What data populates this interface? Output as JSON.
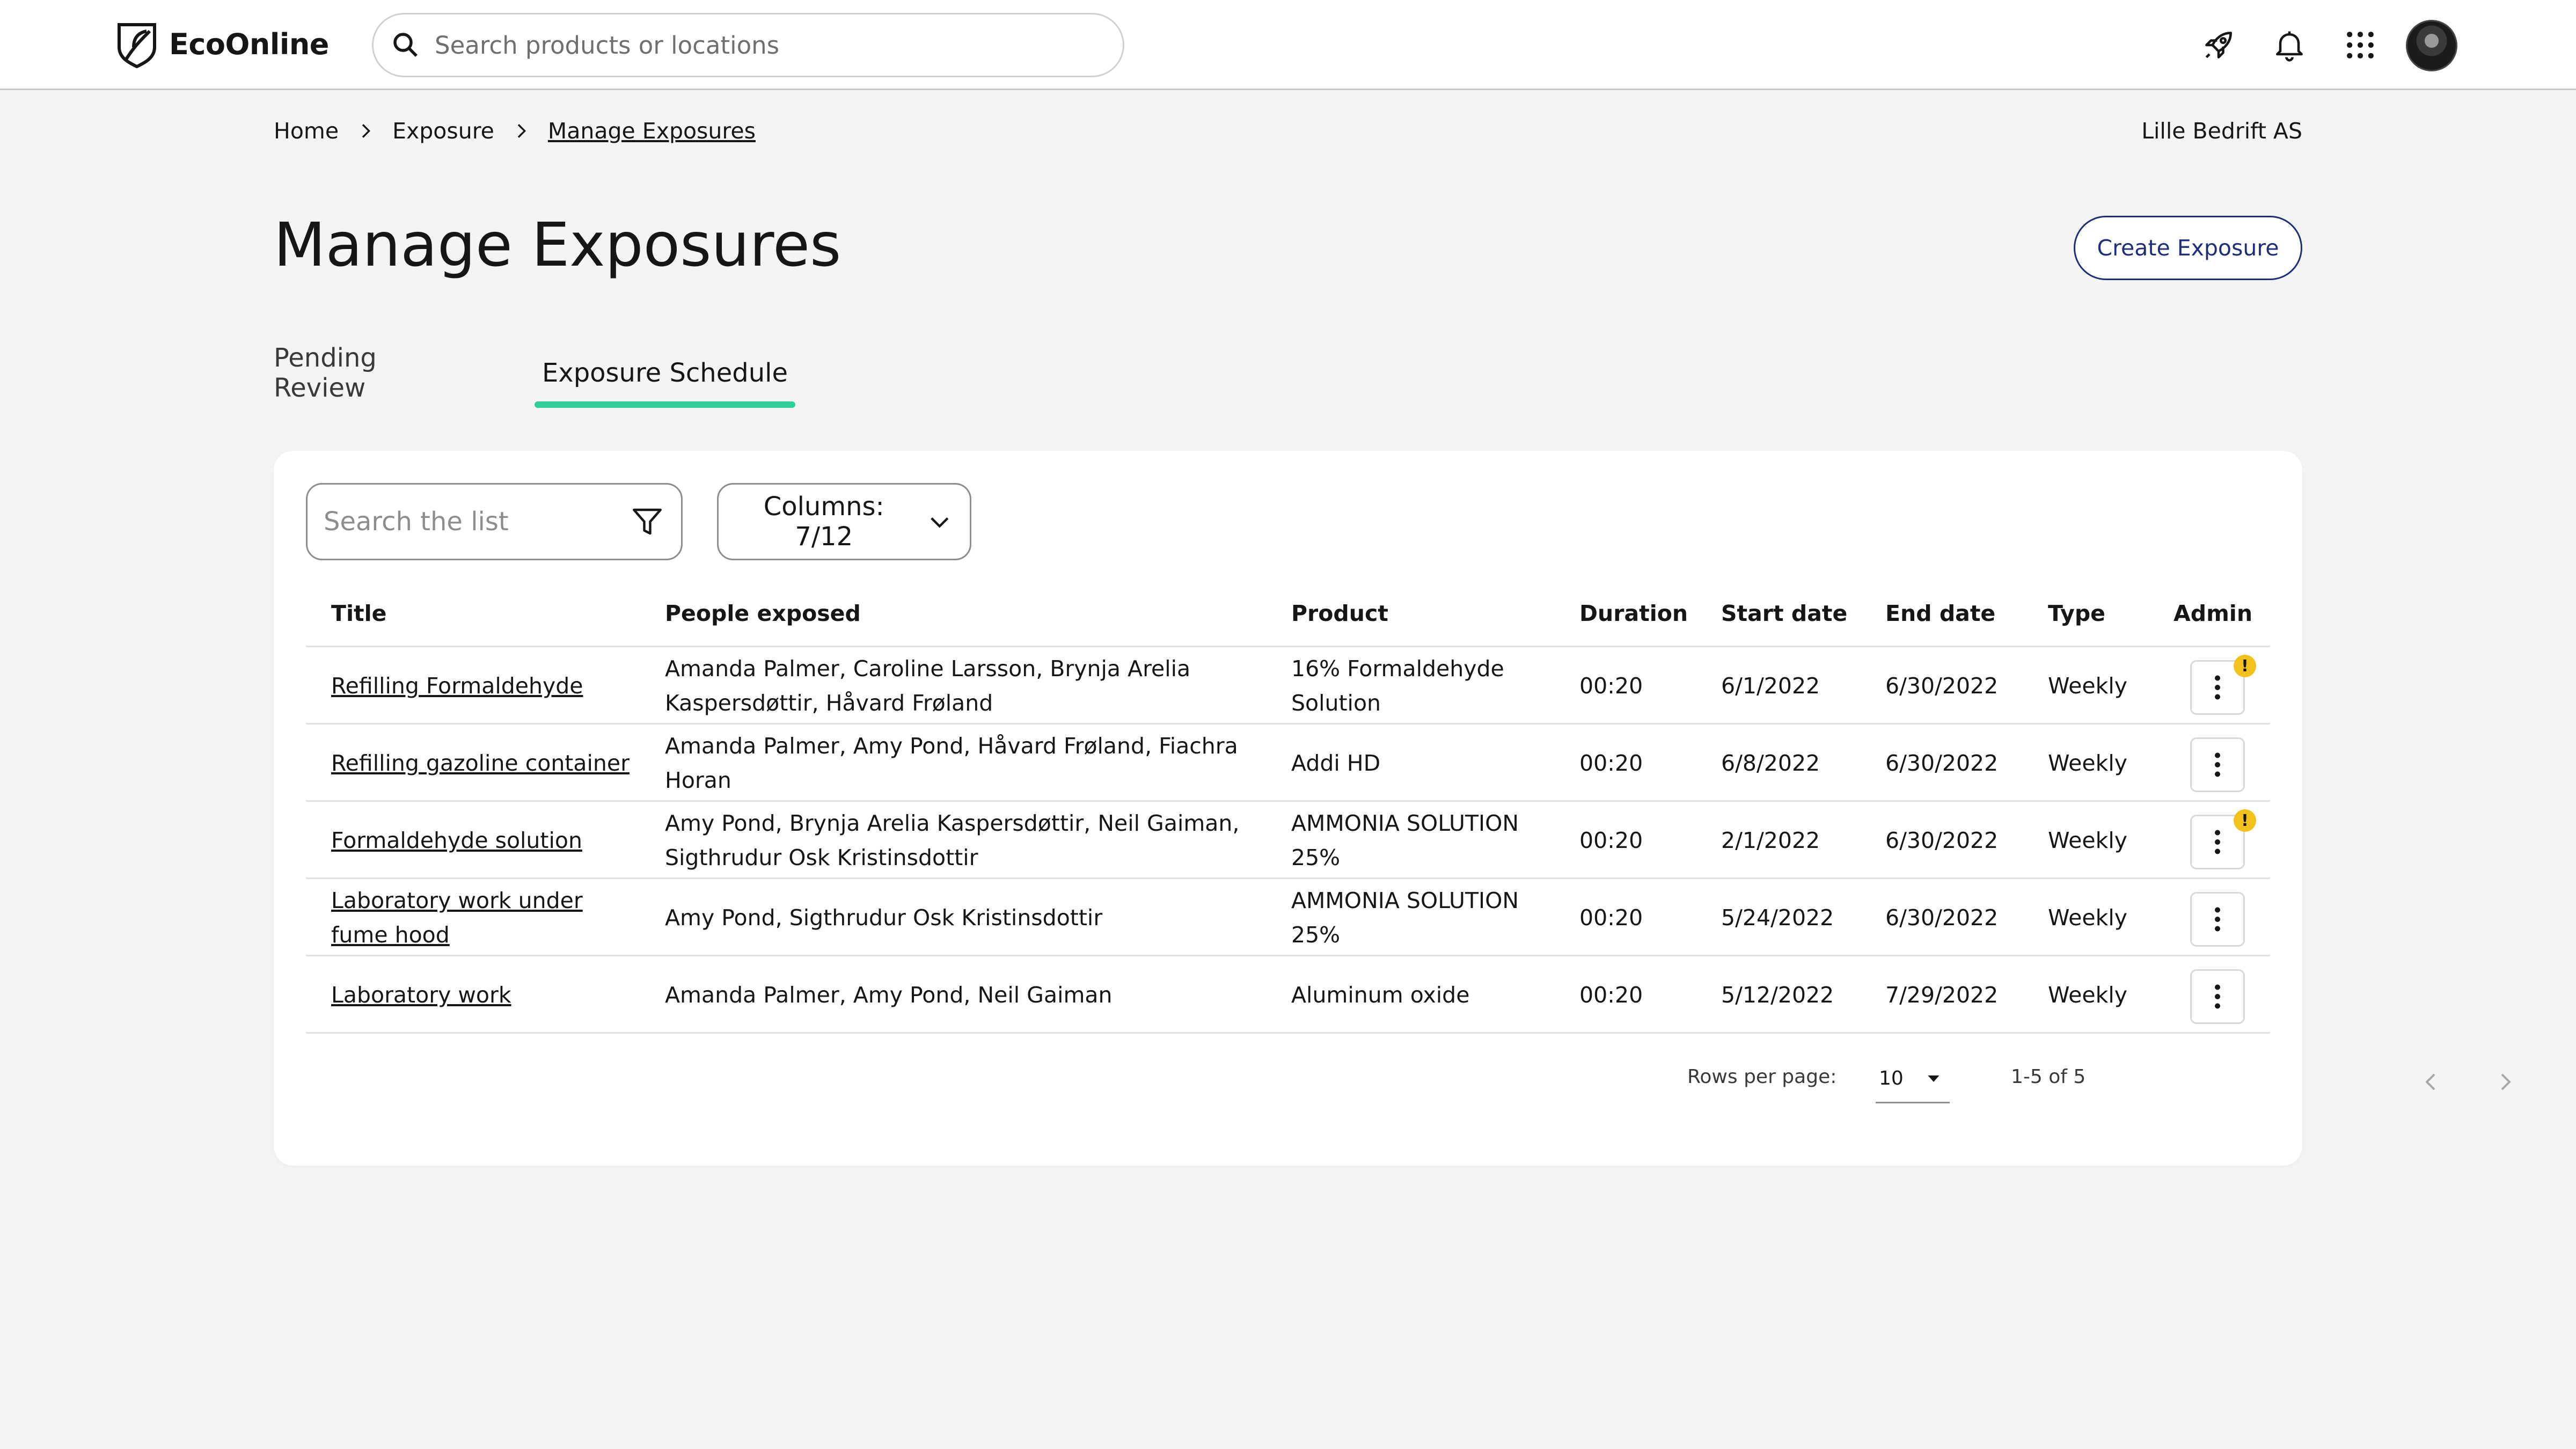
{
  "header": {
    "brand": "EcoOnline",
    "search_placeholder": "Search products or locations",
    "icons": [
      "logo-icon",
      "search-icon",
      "rocket-icon",
      "bell-icon",
      "apps-grid-icon",
      "avatar"
    ]
  },
  "breadcrumb": {
    "items": [
      "Home",
      "Exposure",
      "Manage Exposures"
    ]
  },
  "company": "Lille Bedrift AS",
  "page": {
    "title": "Manage Exposures",
    "create_button": "Create Exposure"
  },
  "tabs": [
    {
      "label": "Pending Review",
      "active": false
    },
    {
      "label": "Exposure Schedule",
      "active": true
    }
  ],
  "toolbar": {
    "search_placeholder": "Search the list",
    "columns_label": "Columns: 7/12"
  },
  "table": {
    "headers": [
      "Title",
      "People exposed",
      "Product",
      "Duration",
      "Start date",
      "End date",
      "Type",
      "Admin"
    ],
    "rows": [
      {
        "title_l1": "Refilling Formaldehyde",
        "title_l2": "",
        "people_l1": "Amanda Palmer, Caroline Larsson, Brynja Arelia",
        "people_l2": "Kaspersdøttir, Håvard Frøland",
        "product_l1": "16% Formaldehyde",
        "product_l2": "Solution",
        "duration": "00:20",
        "start": "6/1/2022",
        "end": "6/30/2022",
        "type": "Weekly",
        "warning": true
      },
      {
        "title_l1": "Refilling gazoline container",
        "title_l2": "",
        "people_l1": "Amanda Palmer, Amy Pond, Håvard Frøland, Fiachra",
        "people_l2": "Horan",
        "product_l1": "Addi HD",
        "product_l2": "",
        "duration": "00:20",
        "start": "6/8/2022",
        "end": "6/30/2022",
        "type": "Weekly",
        "warning": false
      },
      {
        "title_l1": "Formaldehyde solution",
        "title_l2": "",
        "people_l1": "Amy Pond, Brynja Arelia Kaspersdøttir, Neil Gaiman,",
        "people_l2": "Sigthrudur Osk Kristinsdottir",
        "product_l1": "AMMONIA SOLUTION",
        "product_l2": "25%",
        "duration": "00:20",
        "start": "2/1/2022",
        "end": "6/30/2022",
        "type": "Weekly",
        "warning": true
      },
      {
        "title_l1": "Laboratory work under",
        "title_l2": "fume hood",
        "people_l1": "Amy Pond, Sigthrudur Osk Kristinsdottir",
        "people_l2": "",
        "product_l1": "AMMONIA SOLUTION",
        "product_l2": "25%",
        "duration": "00:20",
        "start": "5/24/2022",
        "end": "6/30/2022",
        "type": "Weekly",
        "warning": false
      },
      {
        "title_l1": "Laboratory work",
        "title_l2": "",
        "people_l1": "Amanda Palmer, Amy Pond, Neil Gaiman",
        "people_l2": "",
        "product_l1": "Aluminum oxide",
        "product_l2": "",
        "duration": "00:20",
        "start": "5/12/2022",
        "end": "7/29/2022",
        "type": "Weekly",
        "warning": false
      }
    ]
  },
  "pagination": {
    "rows_per_page_label": "Rows per page:",
    "rows_per_page_value": "10",
    "range": "1-5 of 5"
  },
  "colors": {
    "accent_tab": "#2ecf9a",
    "primary_button": "#1f2d7a",
    "warning_badge": "#f1c21b",
    "background": "#f4f4f4"
  }
}
